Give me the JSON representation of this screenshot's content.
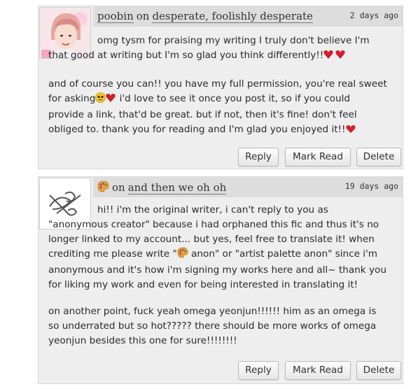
{
  "comments": [
    {
      "author": "poobin",
      "on_word": "on",
      "work": "desperate, foolishly desperate",
      "time": "2 days ago",
      "p1": "omg tysm for praising my writing I truly don't believe I'm that good at writing but I'm so glad you think differently!!",
      "p2a": "and of course you can!! you have my full permission, you're real sweet for asking",
      "p2b": " i'd love to see it once you post it, so if you could provide a link, that'd be great. but if not, then it's fine! don't feel obliged to. thank you for reading and I'm glad you enjoyed it!!"
    },
    {
      "on_word": "on",
      "work": "and then we oh oh",
      "time": "19 days ago",
      "p1a": "hi!! i'm the original writer, i can't reply to you as \"anonymous creator\" because i had orphaned this fic and thus it's no longer linked to my account... but yes, feel free to translate it! when crediting me please write \"",
      "p1b": " anon\" or \"artist palette anon\" since i'm anonymous and it's how i'm signing my works here and all~ thank you for liking my work and even for being interested in translating it!",
      "p2": "on another point, fuck yeah omega yeonjun!!!!!! him as an omega is so underrated but so hot????? there should be more works of omega yeonjun besides this one for sure!!!!!!!!"
    }
  ],
  "buttons": {
    "reply": "Reply",
    "mark_read": "Mark Read",
    "delete": "Delete"
  },
  "colors": {
    "panel": "#eeeeee",
    "header": "#dddddd",
    "emoji_heart": "#d0202a",
    "emoji_face": "#f4c430",
    "palette": "#f0a030"
  },
  "icons": {
    "heart": "red-heart-emoji",
    "sad": "pleading-face-emoji",
    "palette": "artist-palette-emoji",
    "orphan": "orphan-account-icon"
  }
}
